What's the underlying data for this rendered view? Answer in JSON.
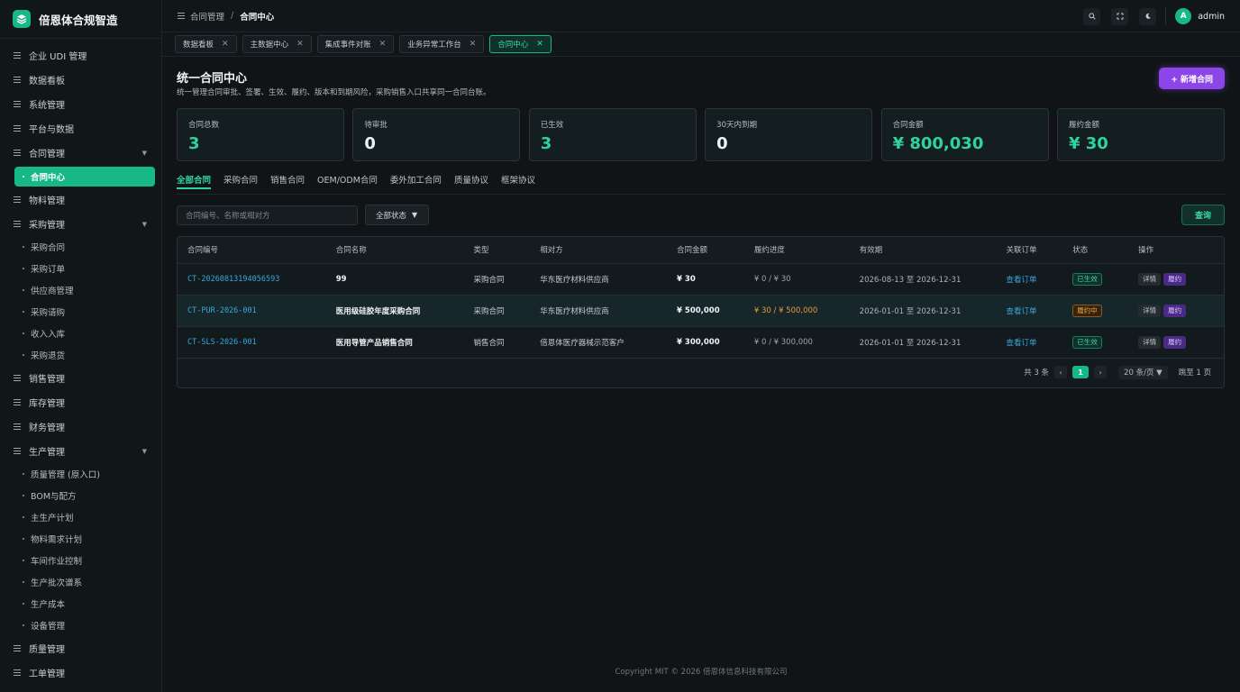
{
  "app": {
    "title": "倍恩体合规智造"
  },
  "sidebar": {
    "items": [
      {
        "label": "企业 UDI 管理",
        "type": "item"
      },
      {
        "label": "数据看板",
        "type": "item"
      },
      {
        "label": "系统管理",
        "type": "item"
      },
      {
        "label": "平台与数据",
        "type": "item"
      },
      {
        "label": "合同管理",
        "type": "group",
        "expanded": true
      },
      {
        "label": "合同中心",
        "type": "active"
      },
      {
        "label": "物料管理",
        "type": "item"
      },
      {
        "label": "采购管理",
        "type": "group",
        "expanded": true
      },
      {
        "label": "采购合同",
        "type": "sub"
      },
      {
        "label": "采购订单",
        "type": "sub"
      },
      {
        "label": "供应商管理",
        "type": "sub"
      },
      {
        "label": "采购请购",
        "type": "sub"
      },
      {
        "label": "收入入库",
        "type": "sub"
      },
      {
        "label": "采购退货",
        "type": "sub"
      },
      {
        "label": "销售管理",
        "type": "item"
      },
      {
        "label": "库存管理",
        "type": "item"
      },
      {
        "label": "财务管理",
        "type": "item"
      },
      {
        "label": "生产管理",
        "type": "group",
        "expanded": true
      },
      {
        "label": "质量管理 (原入口)",
        "type": "sub"
      },
      {
        "label": "BOM与配方",
        "type": "sub"
      },
      {
        "label": "主生产计划",
        "type": "sub"
      },
      {
        "label": "物料需求计划",
        "type": "sub"
      },
      {
        "label": "车间作业控制",
        "type": "sub"
      },
      {
        "label": "生产批次谱系",
        "type": "sub"
      },
      {
        "label": "生产成本",
        "type": "sub"
      },
      {
        "label": "设备管理",
        "type": "sub"
      },
      {
        "label": "质量管理",
        "type": "item"
      },
      {
        "label": "工单管理",
        "type": "item"
      }
    ]
  },
  "topbar": {
    "breadcrumb": [
      "合同管理",
      "合同中心"
    ],
    "icons": [
      "search-icon",
      "fullscreen-icon",
      "theme-icon"
    ],
    "avatar_letter": "A",
    "user": "admin"
  },
  "tabs": [
    {
      "label": "数据看板",
      "active": false
    },
    {
      "label": "主数据中心",
      "active": false
    },
    {
      "label": "集成事件对账",
      "active": false
    },
    {
      "label": "业务异常工作台",
      "active": false
    },
    {
      "label": "合同中心",
      "active": true
    }
  ],
  "page": {
    "title": "统一合同中心",
    "desc": "统一管理合同审批、签署、生效、履约、版本和到期风险，采购销售入口共享同一合同台账。",
    "new_button": "+ 新增合同"
  },
  "stats": [
    {
      "label": "合同总数",
      "value": "3",
      "accent": true
    },
    {
      "label": "待审批",
      "value": "0",
      "accent": false
    },
    {
      "label": "已生效",
      "value": "3",
      "accent": true
    },
    {
      "label": "30天内到期",
      "value": "0",
      "accent": false
    },
    {
      "label": "合同金额",
      "value": "¥ 800,030",
      "accent": true
    },
    {
      "label": "履约金额",
      "value": "¥ 30",
      "accent": true
    }
  ],
  "type_tabs": [
    "全部合同",
    "采购合同",
    "销售合同",
    "OEM/ODM合同",
    "委外加工合同",
    "质量协议",
    "框架协议"
  ],
  "filters": {
    "search_placeholder": "合同编号、名称或相对方",
    "status_select": "全部状态",
    "query_button": "查询"
  },
  "table": {
    "columns": [
      "合同编号",
      "合同名称",
      "类型",
      "相对方",
      "合同金额",
      "履约进度",
      "有效期",
      "关联订单",
      "状态",
      "操作"
    ],
    "rows": [
      {
        "code": "CT-20260813194056593",
        "name": "99",
        "type": "采购合同",
        "party": "华东医疗材料供应商",
        "amount": "¥ 30",
        "progress": "¥ 0 / ¥ 30",
        "progress_active": false,
        "period": "2026-08-13 至 2026-12-31",
        "order": "查看订单",
        "status": "已生效",
        "status_kind": "green",
        "op_detail": "详情",
        "op_perform": "履约"
      },
      {
        "code": "CT-PUR-2026-001",
        "name": "医用级硅胶年度采购合同",
        "type": "采购合同",
        "party": "华东医疗材料供应商",
        "amount": "¥ 500,000",
        "progress": "¥ 30 / ¥ 500,000",
        "progress_active": true,
        "period": "2026-01-01 至 2026-12-31",
        "order": "查看订单",
        "status": "履约中",
        "status_kind": "orange",
        "op_detail": "详情",
        "op_perform": "履约"
      },
      {
        "code": "CT-SLS-2026-001",
        "name": "医用导管产品销售合同",
        "type": "销售合同",
        "party": "倍恩体医疗器械示范客户",
        "amount": "¥ 300,000",
        "progress": "¥ 0 / ¥ 300,000",
        "progress_active": false,
        "period": "2026-01-01 至 2026-12-31",
        "order": "查看订单",
        "status": "已生效",
        "status_kind": "green",
        "op_detail": "详情",
        "op_perform": "履约"
      }
    ]
  },
  "pagination": {
    "total": "共 3 条",
    "prev": "‹",
    "current": "1",
    "next": "›",
    "page_size": "20 条/页 ▼",
    "jump": "跳至 1 页"
  },
  "footer": "Copyright MIT © 2026 倍恩体信息科技有限公司",
  "colors": {
    "accent": "#16b985",
    "brand_purple": "#8b45e8",
    "link": "#3aa7d8",
    "warning": "#e89a3a"
  }
}
